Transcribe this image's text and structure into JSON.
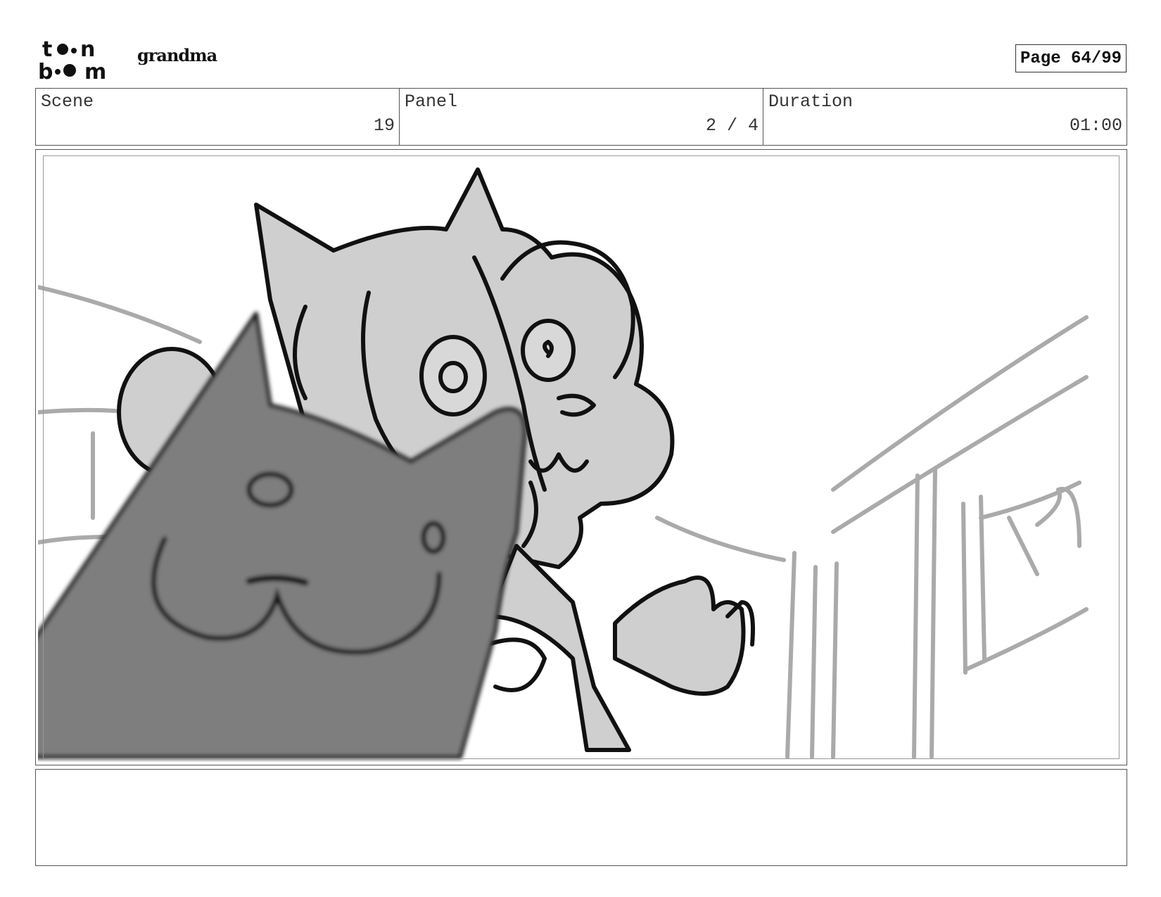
{
  "header": {
    "logo_text": "toon boom",
    "project_name": "grandma",
    "page_label": "Page 64/99"
  },
  "info": {
    "scene_label": "Scene",
    "scene_value": "19",
    "panel_label": "Panel",
    "panel_value": "2 / 4",
    "duration_label": "Duration",
    "duration_value": "01:00"
  },
  "notes": {
    "text": ""
  }
}
